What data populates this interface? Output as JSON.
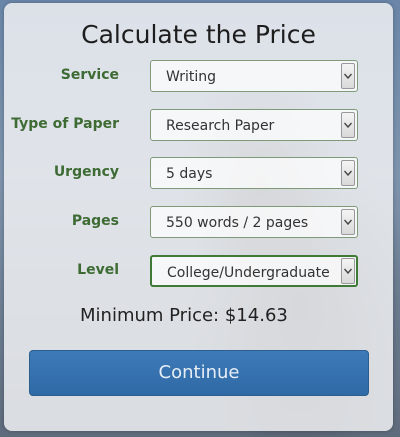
{
  "form": {
    "title": "Calculate the Price",
    "fields": [
      {
        "label": "Service",
        "value": "Writing"
      },
      {
        "label": "Type of Paper",
        "value": "Research Paper"
      },
      {
        "label": "Urgency",
        "value": "5 days"
      },
      {
        "label": "Pages",
        "value": "550 words / 2 pages"
      },
      {
        "label": "Level",
        "value": "College/Undergraduate"
      }
    ],
    "min_price_label": "Minimum Price:",
    "min_price_value": "$14.63",
    "continue_label": "Continue"
  },
  "colors": {
    "label_green": "#3d6b33",
    "button_blue": "#2f6aa6",
    "active_border": "#3f7a36"
  },
  "icons": {
    "select_arrow": "chevron-down-icon"
  }
}
